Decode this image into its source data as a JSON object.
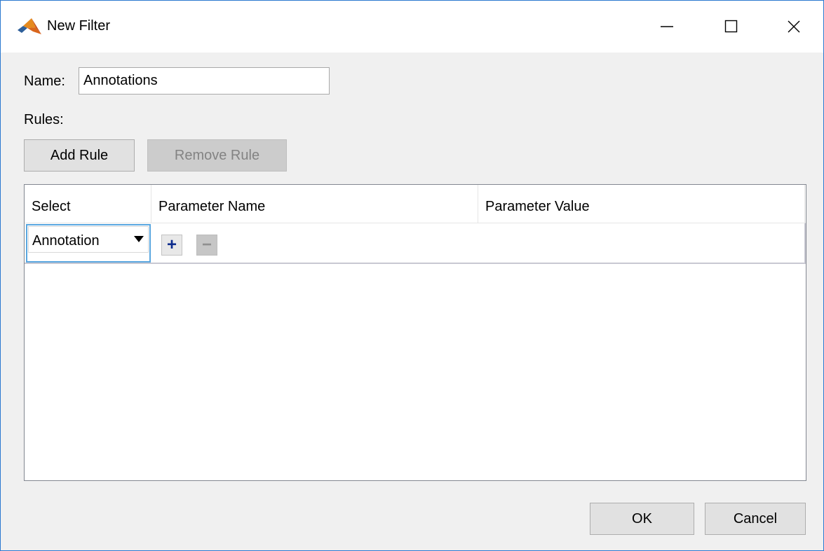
{
  "window": {
    "title": "New Filter",
    "icon": "matlab-logo-icon",
    "controls": [
      "minimize-icon",
      "maximize-icon",
      "close-icon"
    ]
  },
  "form": {
    "name_label": "Name:",
    "name_value": "Annotations",
    "rules_label": "Rules:"
  },
  "toolbar": {
    "add_rule_label": "Add Rule",
    "remove_rule_label": "Remove Rule"
  },
  "table": {
    "columns": [
      "Select",
      "Parameter Name",
      "Parameter Value"
    ],
    "rows": [
      {
        "select": "Annotation"
      }
    ]
  },
  "row_controls": {
    "plus": "+",
    "minus": "−"
  },
  "footer": {
    "ok_label": "OK",
    "cancel_label": "Cancel"
  },
  "colors": {
    "accent": "#2b79d0",
    "focus": "#5aa7e0",
    "plus": "#0b2a8c"
  }
}
